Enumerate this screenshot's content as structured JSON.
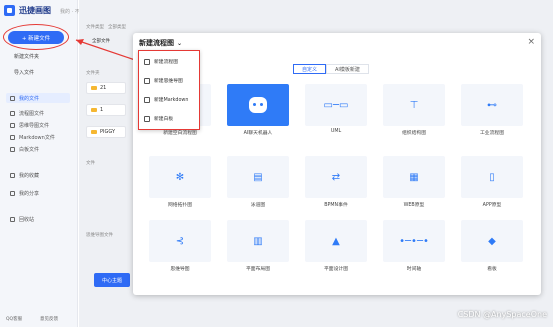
{
  "app": {
    "title": "迅捷画图",
    "subtitle": "我的 · 不确定"
  },
  "sidebar": {
    "new_file": "+ 新建文件",
    "actions": [
      {
        "label": "新建文件夹"
      },
      {
        "label": "导入文件"
      }
    ],
    "nav": [
      {
        "label": "我的文件"
      },
      {
        "label": "流程图文件"
      },
      {
        "label": "思维导图文件"
      },
      {
        "label": "Markdown文件"
      },
      {
        "label": "白板文件"
      },
      {
        "label": "我的收藏"
      },
      {
        "label": "我的分享"
      },
      {
        "label": "回收站"
      }
    ],
    "footer": [
      "QQ客服",
      "意见反馈"
    ]
  },
  "main": {
    "filter_label": "文件类型",
    "filter_value": "全部文件",
    "sort_label": "全部类型",
    "section_folder": "文件夹",
    "folders": [
      "21",
      "1",
      "PIGGY"
    ],
    "section_file": "文件",
    "section_recent": "思维导图文件",
    "bottom_button": "中心主题"
  },
  "modal": {
    "title": "新建流程图",
    "tabs": [
      "自定义",
      "AI模板新建"
    ],
    "dropdown": [
      "新建流程图",
      "新建思维导图",
      "新建Markdown",
      "新建白板"
    ],
    "cards": [
      {
        "label": "新建空白流程图",
        "icon": "blank-icon"
      },
      {
        "label": "AI聊天机器人",
        "icon": "robot-icon"
      },
      {
        "label": "UML",
        "icon": "uml-icon"
      },
      {
        "label": "组织结构图",
        "icon": "org-icon"
      },
      {
        "label": "工业流程图",
        "icon": "industry-icon"
      },
      {
        "label": "网络拓扑图",
        "icon": "network-icon"
      },
      {
        "label": "泳道图",
        "icon": "swimlane-icon"
      },
      {
        "label": "BPMN事件",
        "icon": "bpmn-icon"
      },
      {
        "label": "WEB原型",
        "icon": "web-icon"
      },
      {
        "label": "APP原型",
        "icon": "app-icon"
      },
      {
        "label": "思维导图",
        "icon": "mindmap-icon"
      },
      {
        "label": "平面布局图",
        "icon": "floorplan-icon"
      },
      {
        "label": "平面设计图",
        "icon": "design-icon"
      },
      {
        "label": "时间轴",
        "icon": "timeline-icon"
      },
      {
        "label": "看板",
        "icon": "board-icon"
      }
    ]
  },
  "watermark": "CSDN @AnySpaceOne",
  "colors": {
    "accent": "#2f6bf5",
    "highlight": "#e53935"
  }
}
